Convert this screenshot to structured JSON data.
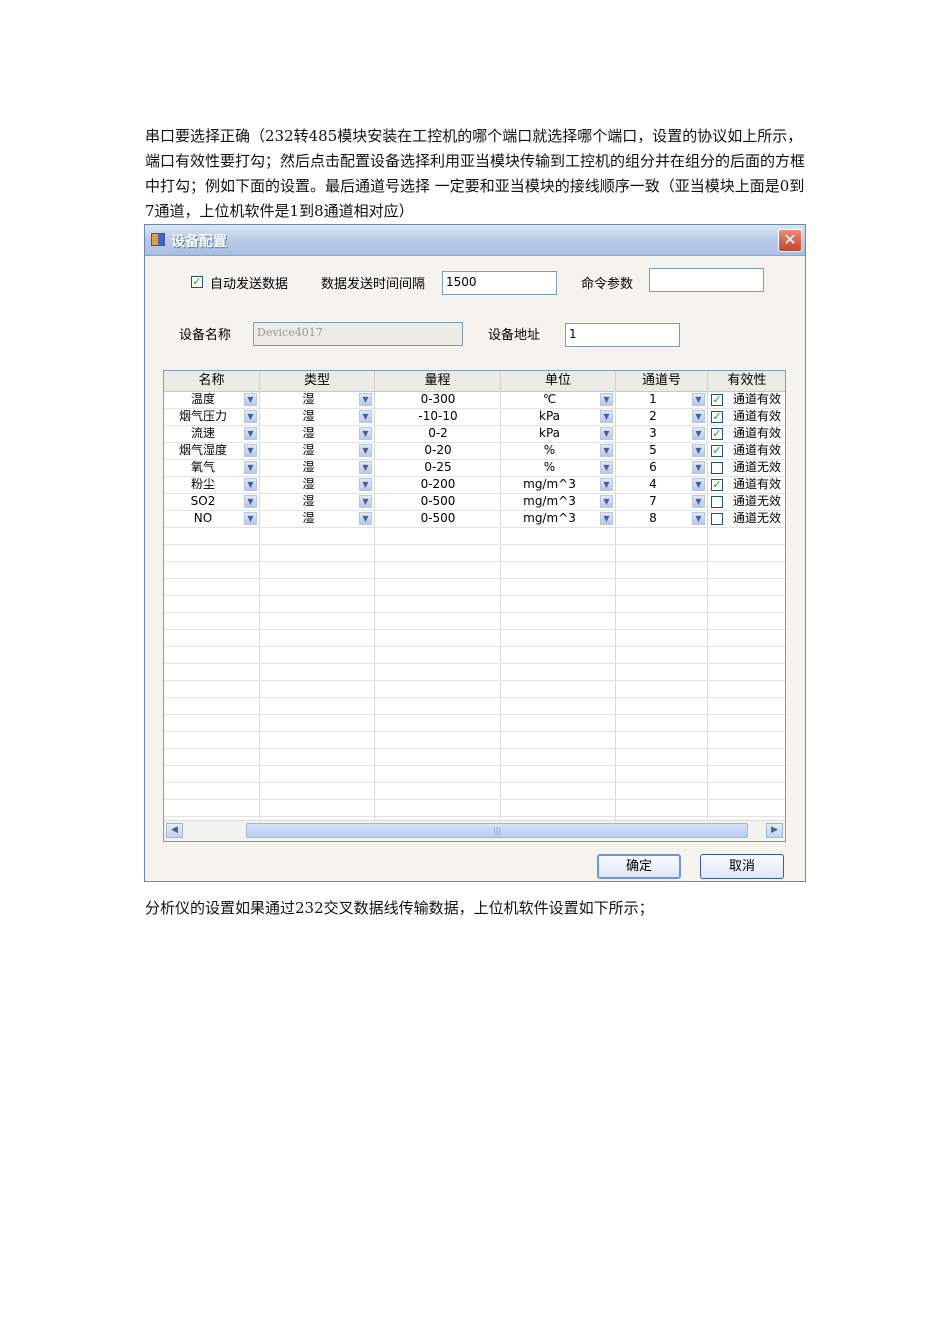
{
  "intro_text": "串口要选择正确（232转485模块安装在工控机的哪个端口就选择哪个端口，设置的协议如上所示，端口有效性要打勾；然后点击配置设备选择利用亚当模块传输到工控机的组分并在组分的后面的方框中打勾；例如下面的设置。最后通道号选择 一定要和亚当模块的接线顺序一致（亚当模块上面是0到7通道，上位机软件是1到8通道相对应）",
  "footer_text": "分析仪的设置如果通过232交叉数据线传输数据，上位机软件设置如下所示；",
  "dialog": {
    "title": "设备配置",
    "close_glyph": "✕",
    "auto_send_label": "自动发送数据",
    "auto_send_checked": true,
    "interval_label": "数据发送时间间隔",
    "interval_value": "1500",
    "cmd_label": "命令参数",
    "cmd_value": "",
    "device_name_label": "设备名称",
    "device_name_value": "Device4017",
    "device_addr_label": "设备地址",
    "device_addr_value": "1",
    "columns": [
      "名称",
      "类型",
      "量程",
      "单位",
      "通道号",
      "有效性"
    ],
    "rows": [
      {
        "name": "温度",
        "type": "湿",
        "range": "0-300",
        "unit": "℃",
        "channel": "1",
        "valid": true,
        "valid_text": "通道有效"
      },
      {
        "name": "烟气压力",
        "type": "湿",
        "range": "-10-10",
        "unit": "kPa",
        "channel": "2",
        "valid": true,
        "valid_text": "通道有效"
      },
      {
        "name": "流速",
        "type": "湿",
        "range": "0-2",
        "unit": "kPa",
        "channel": "3",
        "valid": true,
        "valid_text": "通道有效"
      },
      {
        "name": "烟气湿度",
        "type": "湿",
        "range": "0-20",
        "unit": "%",
        "channel": "5",
        "valid": true,
        "valid_text": "通道有效"
      },
      {
        "name": "氧气",
        "type": "湿",
        "range": "0-25",
        "unit": "%",
        "channel": "6",
        "valid": false,
        "valid_text": "通道无效"
      },
      {
        "name": "粉尘",
        "type": "湿",
        "range": "0-200",
        "unit": "mg/m^3",
        "channel": "4",
        "valid": true,
        "valid_text": "通道有效"
      },
      {
        "name": "SO2",
        "type": "湿",
        "range": "0-500",
        "unit": "mg/m^3",
        "channel": "7",
        "valid": false,
        "valid_text": "通道无效"
      },
      {
        "name": "NO",
        "type": "湿",
        "range": "0-500",
        "unit": "mg/m^3",
        "channel": "8",
        "valid": false,
        "valid_text": "通道无效"
      }
    ],
    "ok_label": "确定",
    "cancel_label": "取消",
    "check_glyph": "✓",
    "dropdown_glyph": "▼",
    "scroll_left_glyph": "◀",
    "scroll_right_glyph": "▶",
    "scroll_grip_glyph": "|||"
  }
}
